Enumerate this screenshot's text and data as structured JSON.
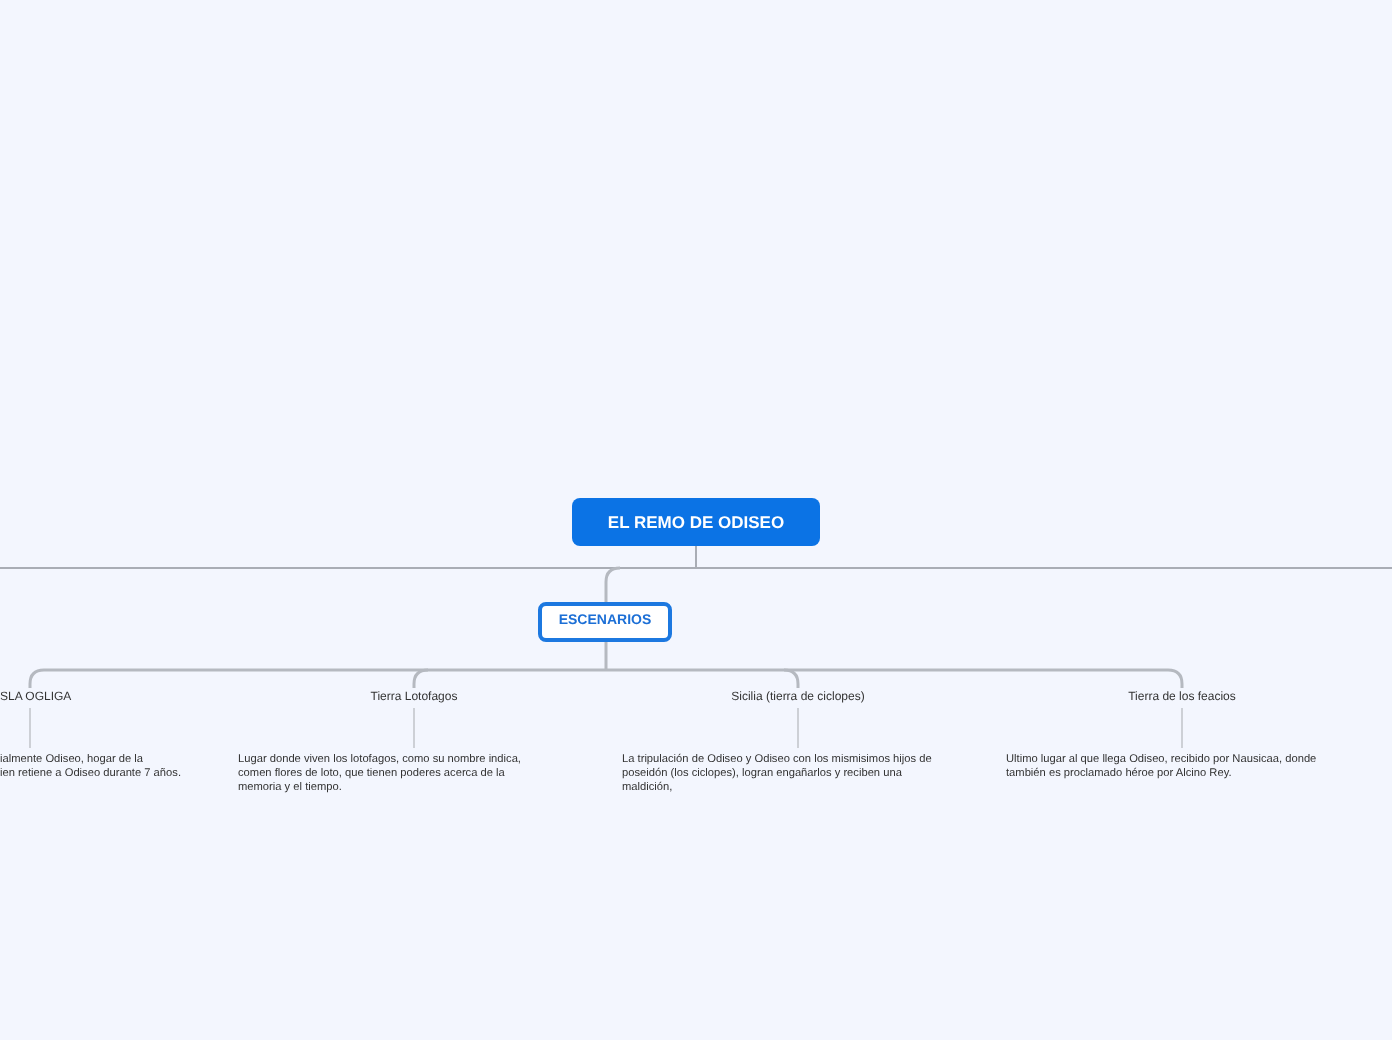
{
  "root": {
    "label": "EL REMO DE ODISEO"
  },
  "main_topic": {
    "label": "ESCENARIOS"
  },
  "subtopics": [
    {
      "label": "SLA OGLIGA",
      "description": "ialmente Odiseo, hogar de la\nien retiene a Odiseo durante 7 años."
    },
    {
      "label": "Tierra Lotofagos",
      "description": "Lugar donde viven los lotofagos, como su nombre indica,\ncomen flores de loto, que tienen poderes acerca de la\nmemoria y el tiempo."
    },
    {
      "label": "Sicilia (tierra de ciclopes)",
      "description": "La tripulación de Odiseo y Odiseo con los mismisimos hijos de\nposeidón (los ciclopes), logran engañarlos y reciben una\nmaldición,"
    },
    {
      "label": "Tierra de los feacios",
      "description": "Ultimo lugar al que llega Odiseo, recibido por Nausicaa, donde\ntambién es proclamado héroe por Alcino Rey."
    }
  ]
}
